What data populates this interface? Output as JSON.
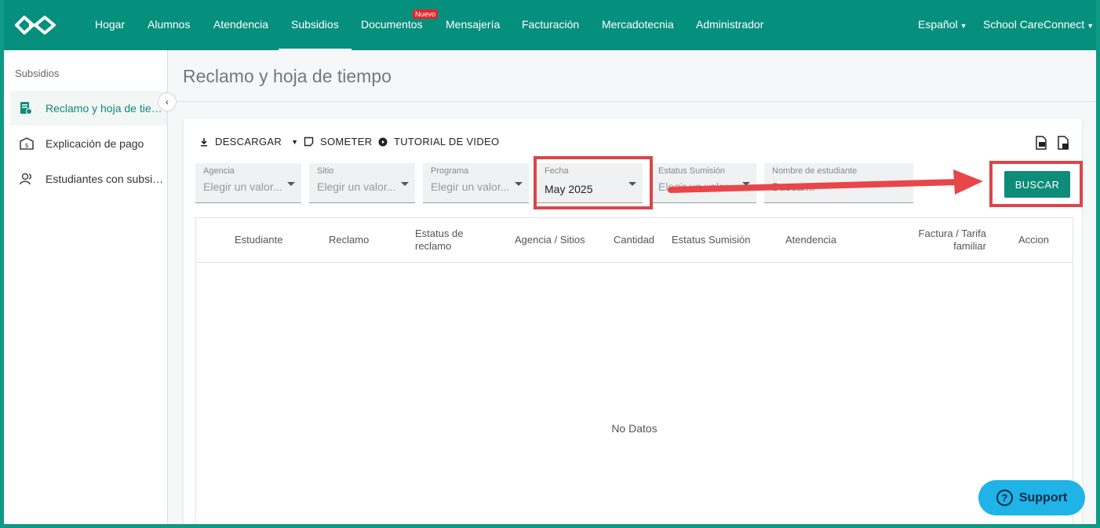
{
  "nav": {
    "items": [
      {
        "label": "Hogar"
      },
      {
        "label": "Alumnos"
      },
      {
        "label": "Atendencia"
      },
      {
        "label": "Subsidios"
      },
      {
        "label": "Documentos",
        "badge": "Nuevo"
      },
      {
        "label": "Mensajería"
      },
      {
        "label": "Facturación"
      },
      {
        "label": "Mercadotecnia"
      },
      {
        "label": "Administrador"
      }
    ],
    "language": "Español",
    "account": "School CareConnect",
    "brand_color": "#058f7d"
  },
  "sidebar": {
    "title": "Subsidios",
    "items": [
      {
        "label": "Reclamo y hoja de tiempo",
        "icon": "claim-document-icon"
      },
      {
        "label": "Explicación de pago",
        "icon": "payment-box-icon"
      },
      {
        "label": "Estudiantes con subsidio",
        "icon": "students-icon"
      }
    ]
  },
  "page": {
    "title": "Reclamo y hoja de tiempo"
  },
  "toolbar": {
    "download": "DESCARGAR",
    "submit": "SOMETER",
    "tutorial": "TUTORIAL DE VIDEO"
  },
  "filters": {
    "agencia": {
      "label": "Agencia",
      "placeholder": "Elegir un valor..."
    },
    "sitio": {
      "label": "Sitio",
      "placeholder": "Elegir un valor..."
    },
    "programa": {
      "label": "Programa",
      "placeholder": "Elegir un valor..."
    },
    "fecha": {
      "label": "Fecha",
      "value": "May 2025"
    },
    "estatus": {
      "label": "Estatus Sumisión",
      "placeholder": "Elegir un valor..."
    },
    "nombre": {
      "label": "Nombre de estudiante",
      "placeholder": "Buscar..."
    }
  },
  "search_button": "BUSCAR",
  "table": {
    "columns": [
      "Estudiante",
      "Reclamo",
      "Estatus de reclamo",
      "Agencia / Sitios",
      "Cantidad",
      "Estatus Sumisión",
      "Atendencia",
      "Factura / Tarifa familiar",
      "Accion"
    ],
    "empty_text": "No Datos"
  },
  "support": {
    "label": "Support"
  },
  "colors": {
    "accent": "#0e8b79",
    "highlight": "#d9464a",
    "support": "#1fb3e8"
  }
}
